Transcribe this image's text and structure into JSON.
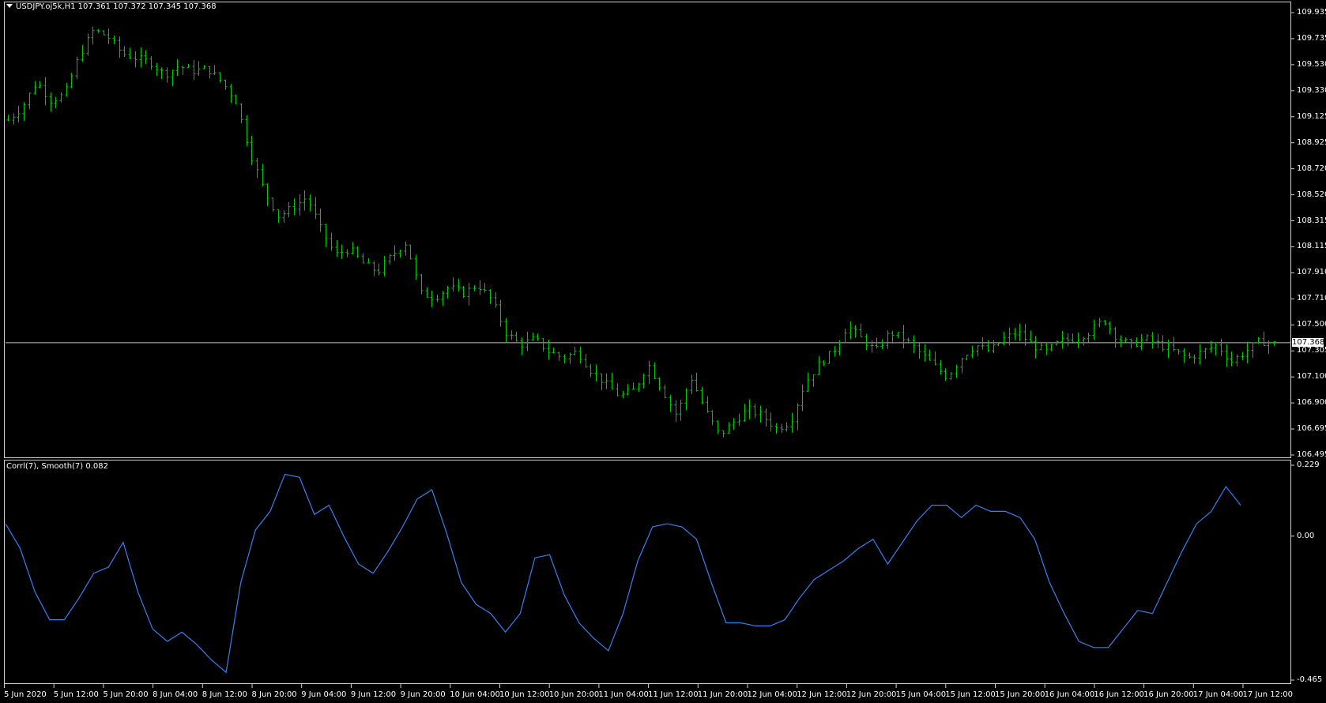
{
  "window": {
    "symbol_info": "USDJPY.oj5k,H1  107.361 107.372 107.345 107.368",
    "indicator_info": "Corrl(7), Smooth(7) 0.082",
    "current_price_label": "107.368"
  },
  "colors": {
    "background": "#000000",
    "bars": "#00c800",
    "indicator_line": "#3a7ff0",
    "price_line": "#c0c0c0",
    "frame": "#d0d0d0",
    "text": "#ffffff"
  },
  "price_axis": {
    "labels": [
      "109.935",
      "109.735",
      "109.530",
      "109.330",
      "109.125",
      "108.925",
      "108.720",
      "108.520",
      "108.315",
      "108.115",
      "107.910",
      "107.710",
      "107.500",
      "107.305",
      "107.100",
      "106.900",
      "106.695",
      "106.495"
    ]
  },
  "indicator_axis": {
    "labels": [
      "0.229",
      "0.00",
      "-0.465"
    ]
  },
  "time_axis": {
    "labels": [
      "5 Jun 2020",
      "5 Jun 12:00",
      "5 Jun 20:00",
      "8 Jun 04:00",
      "8 Jun 12:00",
      "8 Jun 20:00",
      "9 Jun 04:00",
      "9 Jun 12:00",
      "9 Jun 20:00",
      "10 Jun 04:00",
      "10 Jun 12:00",
      "10 Jun 20:00",
      "11 Jun 04:00",
      "11 Jun 12:00",
      "11 Jun 20:00",
      "12 Jun 04:00",
      "12 Jun 12:00",
      "12 Jun 20:00",
      "15 Jun 04:00",
      "15 Jun 12:00",
      "15 Jun 20:00",
      "16 Jun 04:00",
      "16 Jun 12:00",
      "16 Jun 20:00",
      "17 Jun 04:00",
      "17 Jun 12:00"
    ]
  },
  "chart_data": [
    {
      "type": "ohlc",
      "symbol": "USDJPY.oj5k",
      "timeframe": "H1",
      "last_bar": {
        "open": 107.361,
        "high": 107.372,
        "low": 107.345,
        "close": 107.368
      },
      "current_price": 107.368,
      "ylim": [
        106.495,
        109.935
      ],
      "x_start": "5 Jun 2020",
      "x_end": "17 Jun 12:00",
      "close_path": [
        109.1,
        109.2,
        109.4,
        109.25,
        109.3,
        109.6,
        109.8,
        109.75,
        109.62,
        109.58,
        109.55,
        109.45,
        109.52,
        109.48,
        109.5,
        109.4,
        109.25,
        108.85,
        108.55,
        108.35,
        108.42,
        108.5,
        108.25,
        108.05,
        108.1,
        107.98,
        107.92,
        108.05,
        108.15,
        107.75,
        107.72,
        107.8,
        107.75,
        107.82,
        107.7,
        107.45,
        107.35,
        107.4,
        107.3,
        107.25,
        107.3,
        107.15,
        107.05,
        106.95,
        107.0,
        107.2,
        107.0,
        106.8,
        107.1,
        106.85,
        106.65,
        106.75,
        106.85,
        106.8,
        106.7,
        106.75,
        107.05,
        107.2,
        107.3,
        107.5,
        107.4,
        107.3,
        107.45,
        107.4,
        107.3,
        107.2,
        107.1,
        107.25,
        107.35,
        107.3,
        107.4,
        107.45,
        107.35,
        107.3,
        107.38,
        107.4,
        107.45,
        107.55,
        107.4,
        107.35,
        107.4,
        107.35,
        107.3,
        107.25,
        107.3,
        107.35,
        107.22,
        107.3,
        107.38,
        107.36
      ]
    },
    {
      "type": "line",
      "name": "Corrl(7), Smooth(7)",
      "last_value": 0.082,
      "ylim": [
        -0.465,
        0.229
      ],
      "values": [
        0.04,
        -0.04,
        -0.18,
        -0.27,
        -0.27,
        -0.2,
        -0.12,
        -0.1,
        -0.02,
        -0.18,
        -0.3,
        -0.34,
        -0.31,
        -0.35,
        -0.4,
        -0.44,
        -0.15,
        0.02,
        0.08,
        0.2,
        0.19,
        0.07,
        0.1,
        0.0,
        -0.09,
        -0.12,
        -0.05,
        0.03,
        0.12,
        0.15,
        0.01,
        -0.15,
        -0.22,
        -0.25,
        -0.31,
        -0.25,
        -0.07,
        -0.06,
        -0.19,
        -0.28,
        -0.33,
        -0.37,
        -0.25,
        -0.08,
        0.03,
        0.04,
        0.03,
        -0.01,
        -0.15,
        -0.28,
        -0.28,
        -0.29,
        -0.29,
        -0.27,
        -0.2,
        -0.14,
        -0.11,
        -0.08,
        -0.04,
        -0.01,
        -0.09,
        -0.02,
        0.05,
        0.1,
        0.1,
        0.06,
        0.1,
        0.08,
        0.08,
        0.06,
        -0.01,
        -0.15,
        -0.25,
        -0.34,
        -0.36,
        -0.36,
        -0.3,
        -0.24,
        -0.25,
        -0.15,
        -0.05,
        0.04,
        0.08,
        0.16,
        0.1
      ]
    }
  ]
}
